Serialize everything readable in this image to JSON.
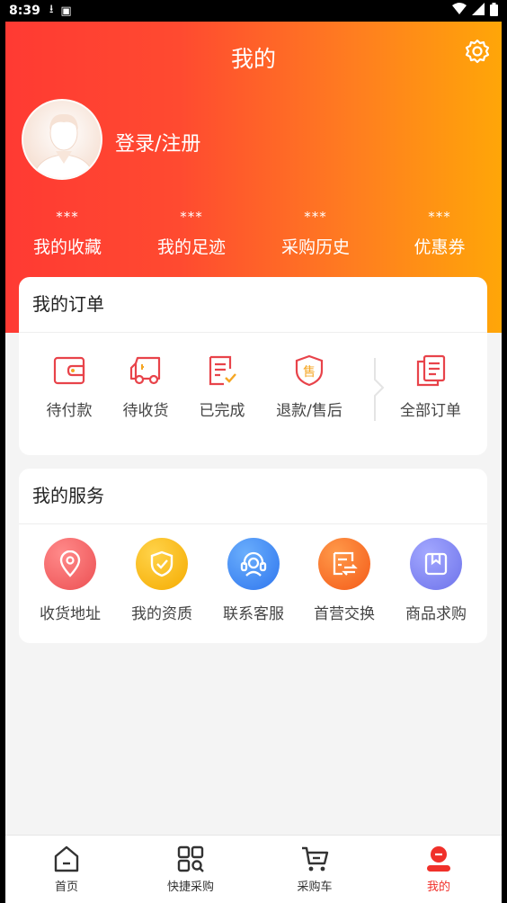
{
  "status_bar": {
    "time": "8:39"
  },
  "header": {
    "title": "我的",
    "login_label": "登录/注册",
    "stats": [
      {
        "value": "***",
        "label": "我的收藏"
      },
      {
        "value": "***",
        "label": "我的足迹"
      },
      {
        "value": "***",
        "label": "采购历史"
      },
      {
        "value": "***",
        "label": "优惠券"
      }
    ]
  },
  "orders": {
    "title": "我的订单",
    "items": [
      {
        "label": "待付款",
        "icon": "wallet-icon"
      },
      {
        "label": "待收货",
        "icon": "truck-icon"
      },
      {
        "label": "已完成",
        "icon": "check-document-icon"
      },
      {
        "label": "退款/售后",
        "icon": "shield-after-sale-icon"
      },
      {
        "label": "全部订单",
        "icon": "order-list-icon"
      }
    ]
  },
  "services": {
    "title": "我的服务",
    "items": [
      {
        "label": "收货地址",
        "icon": "location-pin-icon",
        "color": "#f25a5a"
      },
      {
        "label": "我的资质",
        "icon": "shield-check-icon",
        "color": "#f8b70c"
      },
      {
        "label": "联系客服",
        "icon": "customer-service-icon",
        "color": "#3f8af5"
      },
      {
        "label": "首营交换",
        "icon": "exchange-document-icon",
        "color": "#fb6a22"
      },
      {
        "label": "商品求购",
        "icon": "box-icon",
        "color": "#7f86f4"
      }
    ]
  },
  "bottom_nav": {
    "items": [
      {
        "label": "首页",
        "icon": "home-icon"
      },
      {
        "label": "快捷采购",
        "icon": "quick-purchase-icon"
      },
      {
        "label": "采购车",
        "icon": "cart-icon"
      },
      {
        "label": "我的",
        "icon": "profile-icon",
        "active": true
      }
    ]
  },
  "colors": {
    "accent": "#f0302a",
    "header_gradient_start": "#ff3a33",
    "header_gradient_end": "#ffa608"
  }
}
